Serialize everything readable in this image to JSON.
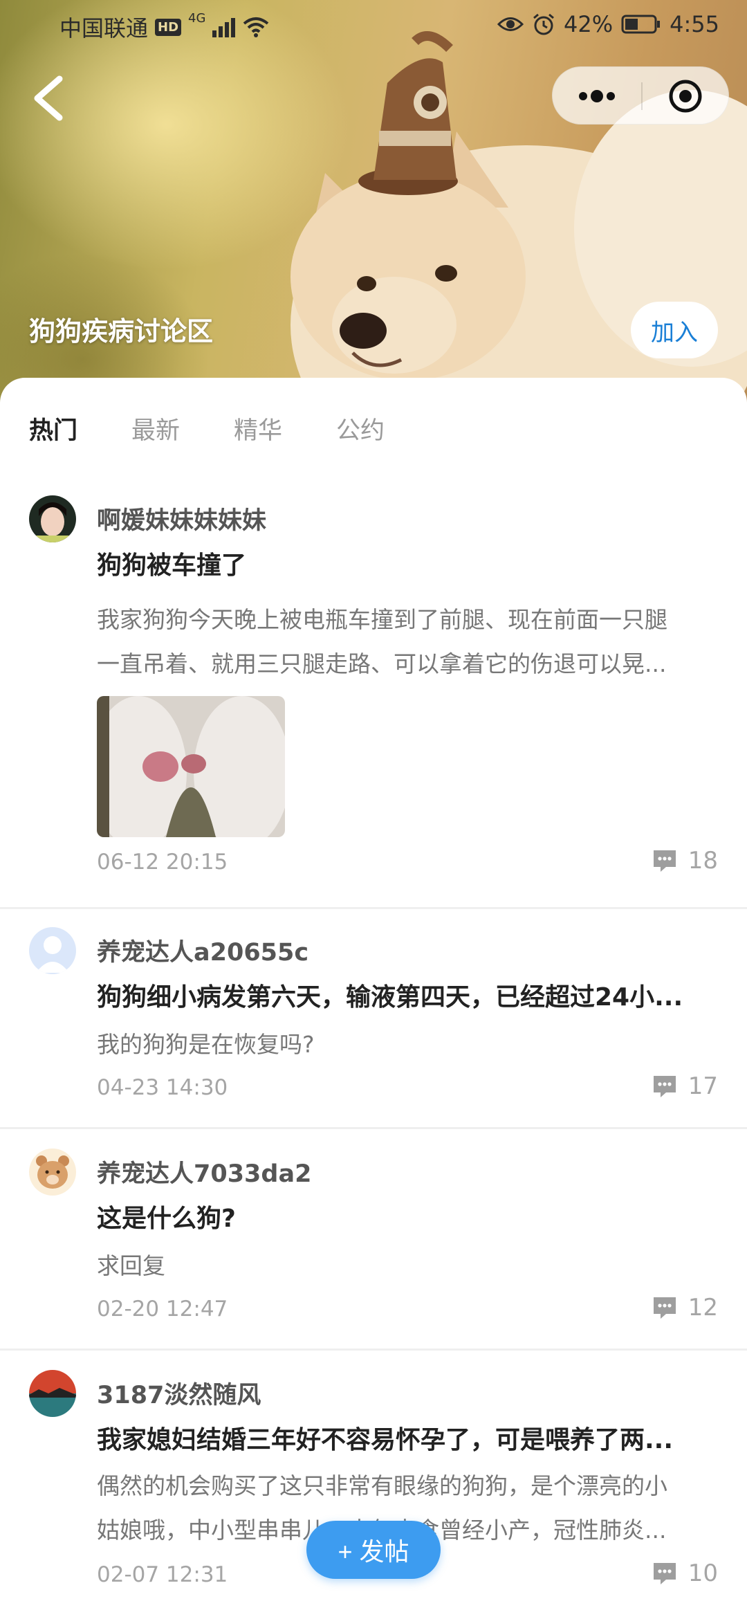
{
  "status_bar": {
    "carrier": "中国联通",
    "hd": "HD",
    "network": "4G",
    "battery": "42%",
    "time": "4:55"
  },
  "header": {
    "group_title": "狗狗疾病讨论区",
    "join_label": "加入"
  },
  "tabs": [
    {
      "label": "热门",
      "active": true
    },
    {
      "label": "最新",
      "active": false
    },
    {
      "label": "精华",
      "active": false
    },
    {
      "label": "公约",
      "active": false
    }
  ],
  "posts": [
    {
      "user": "啊媛妹妹妹妹妹",
      "title": "狗狗被车撞了",
      "body": [
        "我家狗狗今天晚上被电瓶车撞到了前腿、现在前面一只腿",
        "一直吊着、就用三只腿走路、可以拿着它的伤退可以晃..."
      ],
      "date": "06-12 20:15",
      "comments": "18"
    },
    {
      "user": "养宠达人a20655c",
      "title": "狗狗细小病发第六天，输液第四天，已经超过24小...",
      "body": [
        "我的狗狗是在恢复吗?"
      ],
      "date": "04-23 14:30",
      "comments": "17"
    },
    {
      "user": "养宠达人7033da2",
      "title": "这是什么狗?",
      "body": [
        "求回复"
      ],
      "date": "02-20 12:47",
      "comments": "12"
    },
    {
      "user": "3187淡然随风",
      "title": "我家媳妇结婚三年好不容易怀孕了，可是喂养了两...",
      "body": [
        "偶然的机会购买了这只非常有眼缘的狗狗，是个漂亮的小",
        "姑娘哦，中小型串串儿，去年走食曾经小产，冠性肺炎..."
      ],
      "date": "02-07 12:31",
      "comments": "10"
    }
  ],
  "fab_label": "+ 发帖",
  "colors": {
    "accent": "#3d9cf0",
    "join_text": "#1a7fd6",
    "meta_gray": "#a5a5a5"
  }
}
